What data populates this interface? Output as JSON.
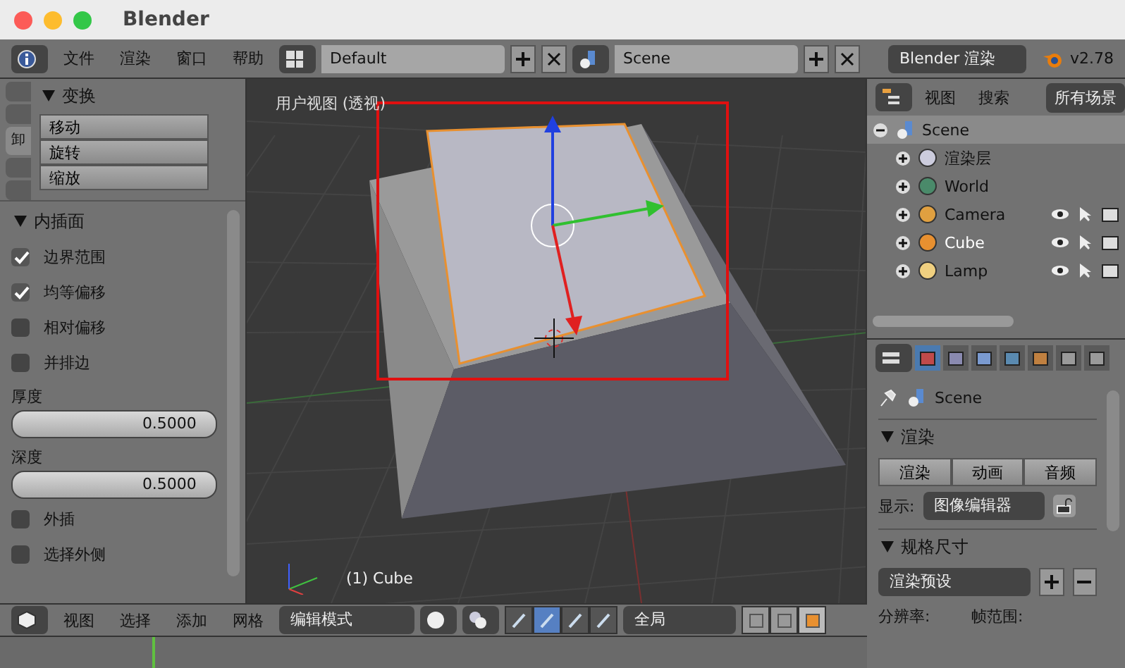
{
  "window": {
    "title": "Blender"
  },
  "top_header": {
    "menus": [
      "文件",
      "渲染",
      "窗口",
      "帮助"
    ],
    "layout": "Default",
    "scene": "Scene",
    "engine": "Blender 渲染",
    "version": "v2.78"
  },
  "tool_shelf": {
    "tabs": [
      {
        "label": "卸",
        "selected": true
      }
    ],
    "transform": {
      "title": "变换",
      "buttons": [
        "移动",
        "旋转",
        "缩放"
      ]
    },
    "inset": {
      "title": "内插面",
      "options": [
        {
          "kind": "checkbox",
          "label": "边界范围",
          "checked": true
        },
        {
          "kind": "checkbox",
          "label": "均等偏移",
          "checked": true
        },
        {
          "kind": "checkbox",
          "label": "相对偏移",
          "checked": false
        },
        {
          "kind": "checkbox",
          "label": "并排边",
          "checked": false
        },
        {
          "kind": "number",
          "label": "厚度",
          "value": "0.5000"
        },
        {
          "kind": "number",
          "label": "深度",
          "value": "0.5000"
        },
        {
          "kind": "checkbox",
          "label": "外插",
          "checked": false
        },
        {
          "kind": "checkbox",
          "label": "选择外侧",
          "checked": false
        }
      ]
    }
  },
  "viewport": {
    "title": "用户视图 (透视)",
    "object_label": "(1) Cube"
  },
  "viewport_header": {
    "menus": [
      "视图",
      "选择",
      "添加",
      "网格"
    ],
    "mode": "编辑模式",
    "manipulators": [
      {
        "selected": false
      },
      {
        "selected": true
      },
      {
        "selected": false
      },
      {
        "selected": false
      }
    ],
    "orientation": "全局",
    "select_modes": [
      {
        "selected": false
      },
      {
        "selected": false
      },
      {
        "selected": true
      }
    ]
  },
  "outliner": {
    "menus": [
      "视图",
      "搜索"
    ],
    "filter": "所有场景",
    "tree": [
      {
        "label": "Scene",
        "expanded": true,
        "children": [
          {
            "label": "渲染层",
            "selected": false
          },
          {
            "label": "World",
            "selected": false
          },
          {
            "label": "Camera",
            "selected": false
          },
          {
            "label": "Cube",
            "selected": true
          },
          {
            "label": "Lamp",
            "selected": false
          }
        ]
      }
    ]
  },
  "properties": {
    "tabs": [
      {
        "selected": true
      },
      {
        "selected": false
      },
      {
        "selected": false
      },
      {
        "selected": false
      },
      {
        "selected": false
      },
      {
        "selected": false
      },
      {
        "selected": false
      }
    ],
    "breadcrumb": "Scene",
    "render": {
      "title": "渲染",
      "buttons": [
        "渲染",
        "动画",
        "音频"
      ],
      "display_label": "显示:",
      "display_value": "图像编辑器"
    },
    "dimensions": {
      "title": "规格尺寸",
      "preset": "渲染预设",
      "resolution_label": "分辨率:",
      "frame_range_label": "帧范围:"
    }
  }
}
